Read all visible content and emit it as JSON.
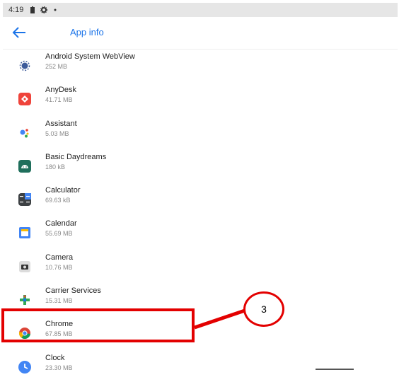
{
  "status_bar": {
    "time": "4:19"
  },
  "app_bar": {
    "title": "App info"
  },
  "apps": [
    {
      "name": "Android System WebView",
      "size": "252 MB",
      "icon": "webview-icon"
    },
    {
      "name": "AnyDesk",
      "size": "41.71 MB",
      "icon": "anydesk-icon"
    },
    {
      "name": "Assistant",
      "size": "5.03 MB",
      "icon": "assistant-icon"
    },
    {
      "name": "Basic Daydreams",
      "size": "180 kB",
      "icon": "daydreams-icon"
    },
    {
      "name": "Calculator",
      "size": "69.63 kB",
      "icon": "calculator-icon"
    },
    {
      "name": "Calendar",
      "size": "55.69 MB",
      "icon": "calendar-icon"
    },
    {
      "name": "Camera",
      "size": "10.76 MB",
      "icon": "camera-icon"
    },
    {
      "name": "Carrier Services",
      "size": "15.31 MB",
      "icon": "carrier-services-icon"
    },
    {
      "name": "Chrome",
      "size": "67.85 MB",
      "icon": "chrome-icon"
    },
    {
      "name": "Clock",
      "size": "23.30 MB",
      "icon": "clock-icon"
    }
  ],
  "annotation": {
    "step_number": "3",
    "color": "#e30000"
  },
  "colors": {
    "accent": "#1a73e8",
    "status_bar_bg": "#e6e6e6"
  }
}
